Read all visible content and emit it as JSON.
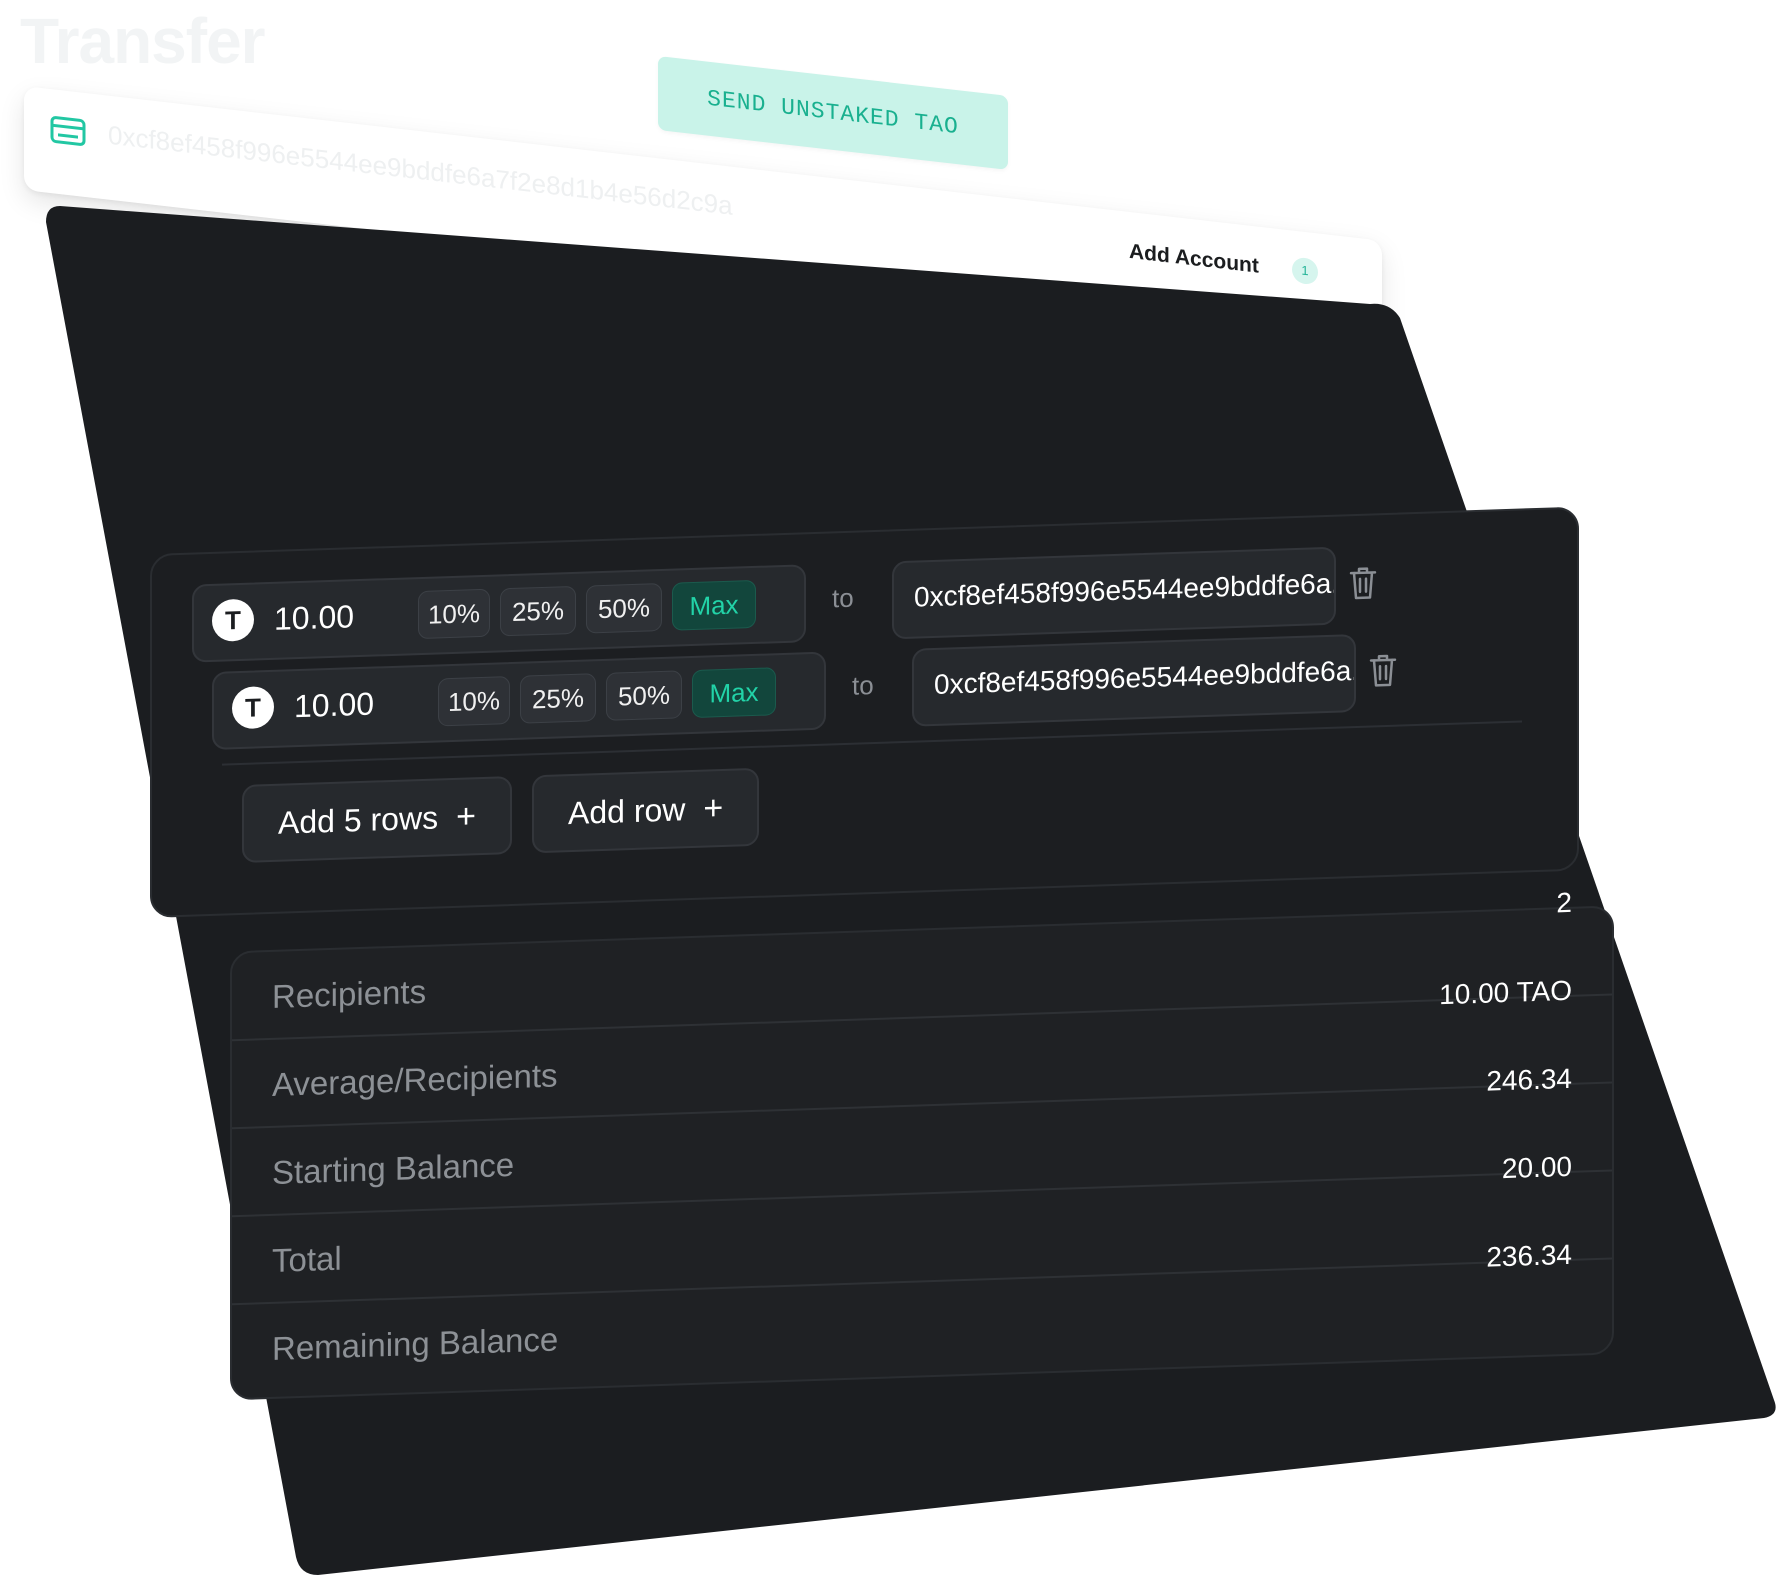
{
  "ghost_title": "Transfer",
  "badge": "SEND UNSTAKED TAO",
  "account": {
    "address": "0xcf8ef458f996e5544ee9bddfe6a7f2e8d1b4e56d2c9a",
    "add_label": "Add Account",
    "count": "1",
    "icon": "wallet-icon"
  },
  "colors": {
    "accent": "#22d3a8",
    "panel": "#1b1d20",
    "badge_bg": "#c9f3e9"
  },
  "rows": [
    {
      "token_symbol": "T",
      "amount": "10.00",
      "percents": [
        "10%",
        "25%",
        "50%"
      ],
      "max_label": "Max",
      "to": "to",
      "address": "0xcf8ef458f996e5544ee9bddfe6a..."
    },
    {
      "token_symbol": "T",
      "amount": "10.00",
      "percents": [
        "10%",
        "25%",
        "50%"
      ],
      "max_label": "Max",
      "to": "to",
      "address": "0xcf8ef458f996e5544ee9bddfe6a..."
    }
  ],
  "buttons": {
    "add_five": "Add 5 rows",
    "add_one": "Add row",
    "plus": "+"
  },
  "stats": [
    {
      "label": "Recipients",
      "value": "2"
    },
    {
      "label": "Average/Recipients",
      "value": "10.00 TAO"
    },
    {
      "label": "Starting Balance",
      "value": "246.34"
    },
    {
      "label": "Total",
      "value": "20.00"
    },
    {
      "label": "Remaining Balance",
      "value": "236.34"
    }
  ]
}
